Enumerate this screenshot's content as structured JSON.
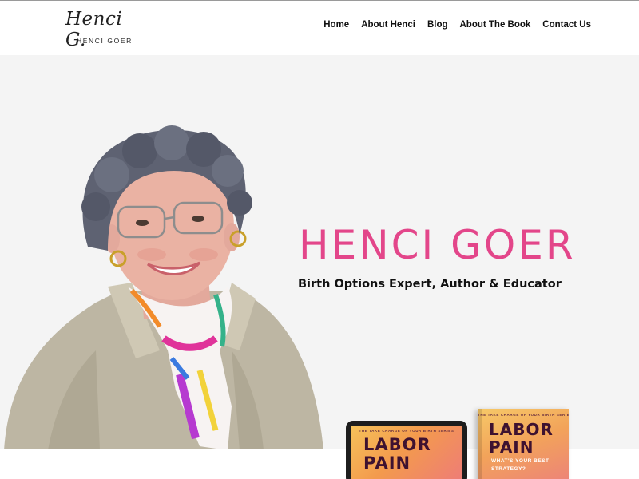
{
  "site": {
    "logo_script": "Henci G.",
    "logo_name": "HENCI GOER"
  },
  "nav": {
    "items": [
      {
        "label": "Home"
      },
      {
        "label": "About Henci"
      },
      {
        "label": "Blog"
      },
      {
        "label": "About The Book"
      },
      {
        "label": "Contact Us"
      }
    ]
  },
  "hero": {
    "title": "HENCI GOER",
    "subtitle": "Birth Options Expert, Author & Educator",
    "accent_color": "#e3468a",
    "background_color": "#f4f4f4"
  },
  "books": {
    "series_label": "THE TAKE CHARGE OF YOUR BIRTH SERIES",
    "title_line1": "LABOR",
    "title_line2": "PAIN",
    "tagline_line1": "WHAT'S YOUR BEST",
    "tagline_line2": "STRATEGY?"
  }
}
